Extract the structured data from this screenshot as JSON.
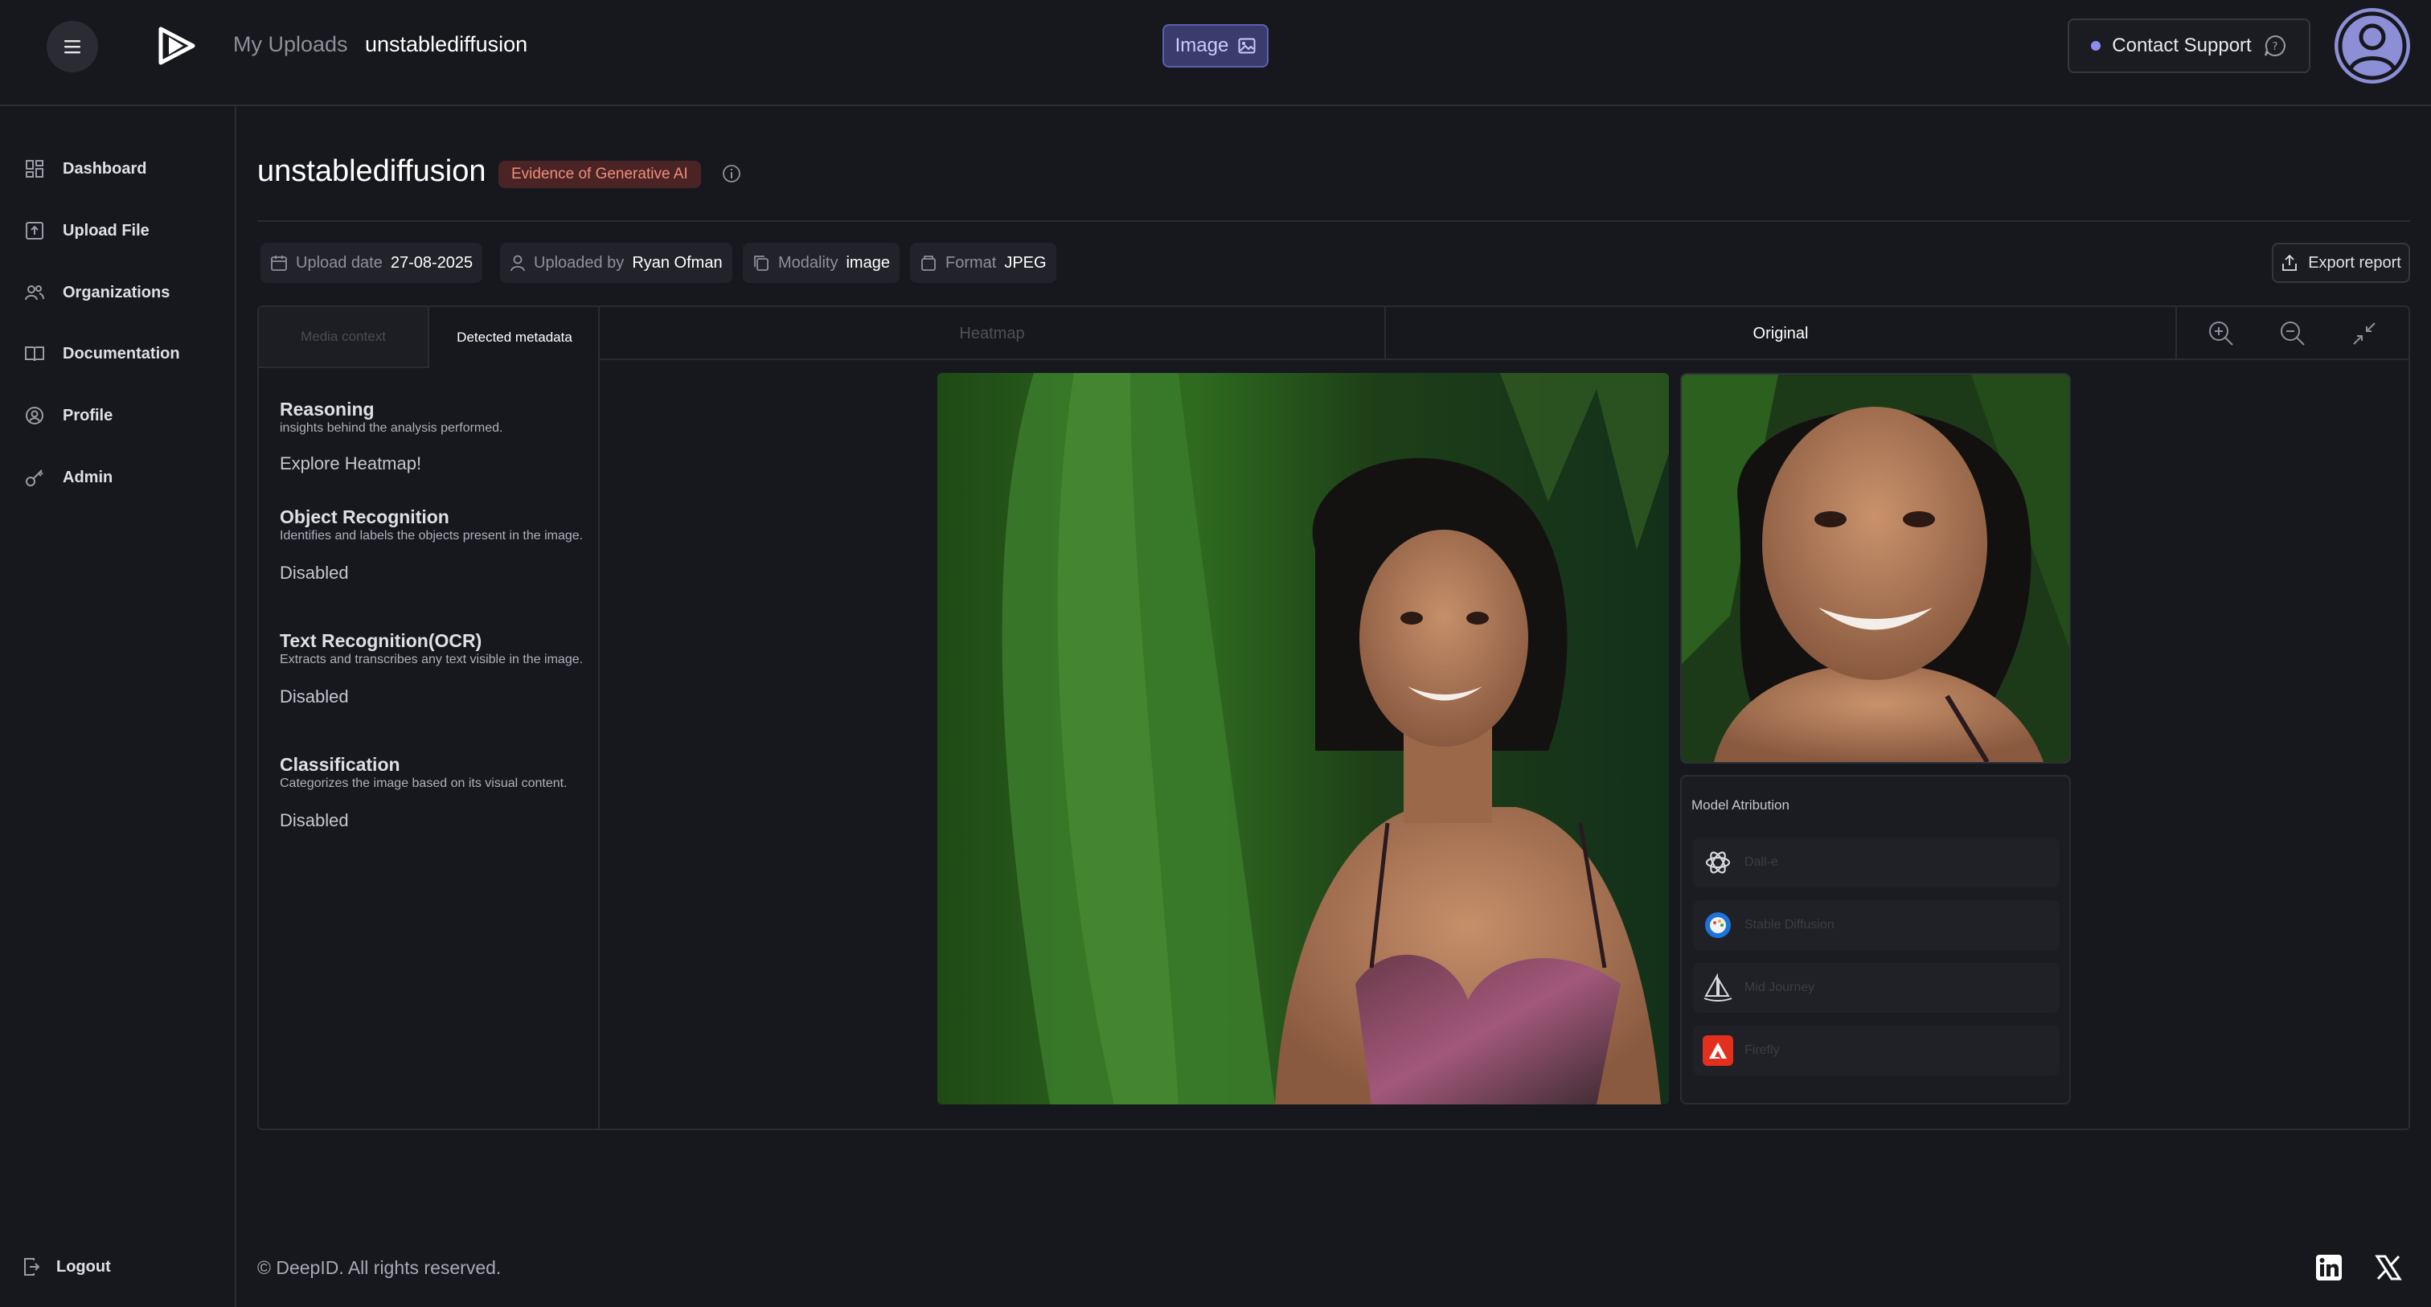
{
  "header": {
    "breadcrumb_root": "My Uploads",
    "breadcrumb_current": "unstablediffusion",
    "modality_chip": "Image",
    "support_label": "Contact Support"
  },
  "sidebar": {
    "items": [
      {
        "label": "Dashboard",
        "icon": "dashboard-icon"
      },
      {
        "label": "Upload File",
        "icon": "upload-icon"
      },
      {
        "label": "Organizations",
        "icon": "users-icon"
      },
      {
        "label": "Documentation",
        "icon": "book-icon"
      },
      {
        "label": "Profile",
        "icon": "profile-icon"
      },
      {
        "label": "Admin",
        "icon": "key-icon"
      }
    ],
    "logout": "Logout"
  },
  "page": {
    "title": "unstablediffusion",
    "verdict": "Evidence of Generative AI"
  },
  "meta": {
    "upload_date_label": "Upload date",
    "upload_date": "27-08-2025",
    "uploaded_by_label": "Uploaded by",
    "uploaded_by": "Ryan Ofman",
    "modality_label": "Modality",
    "modality": "image",
    "format_label": "Format",
    "format": "JPEG",
    "export_label": "Export report"
  },
  "left_tabs": {
    "media_context": "Media context",
    "detected_metadata": "Detected metadata"
  },
  "sections": [
    {
      "title": "Reasoning",
      "desc": "insights behind the analysis performed.",
      "value": "Explore Heatmap!"
    },
    {
      "title": "Object Recognition",
      "desc": "Identifies and labels the objects present in the image.",
      "value": "Disabled"
    },
    {
      "title": "Text Recognition(OCR)",
      "desc": "Extracts and transcribes any text visible in the image.",
      "value": "Disabled"
    },
    {
      "title": "Classification",
      "desc": "Categorizes the image based on its visual content.",
      "value": "Disabled"
    }
  ],
  "viewer": {
    "tab_heatmap": "Heatmap",
    "tab_original": "Original"
  },
  "attribution": {
    "title": "Model Atribution",
    "models": [
      {
        "name": "Dall-e",
        "icon": "openai-icon"
      },
      {
        "name": "Stable Diffusion",
        "icon": "stable-diffusion-icon"
      },
      {
        "name": "Mid Journey",
        "icon": "midjourney-icon"
      },
      {
        "name": "Firefly",
        "icon": "firefly-icon"
      }
    ]
  },
  "footer": {
    "copyright": "© DeepID. All rights reserved."
  },
  "colors": {
    "background": "#17181e",
    "accent": "#8b8ef0",
    "verdict_bg": "#4a2424",
    "verdict_text": "#f08c7c"
  }
}
